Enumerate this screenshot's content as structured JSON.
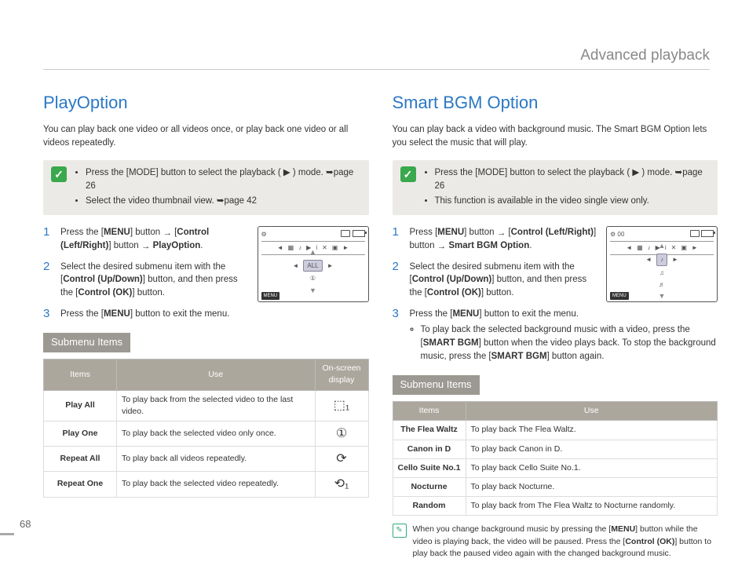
{
  "chapter_title": "Advanced playback",
  "page_number": "68",
  "left": {
    "title": "PlayOption",
    "intro": "You can play back one video or all videos once, or play back one video or all videos repeatedly.",
    "note_items": [
      "Press the [MODE] button to select the playback ( ▶ ) mode. ➥page 26",
      "Select the video thumbnail view. ➥page 42"
    ],
    "steps": [
      "Press the [MENU] button → [Control (Left/Right)] button → PlayOption.",
      "Select the desired submenu item with the [Control (Up/Down)] button, and then press the [Control (OK)] button.",
      "Press the [MENU] button to exit the menu."
    ],
    "submenu_label": "Submenu Items",
    "table": {
      "headers": [
        "Items",
        "Use",
        "On-screen display"
      ],
      "rows": [
        {
          "item": "Play All",
          "use": "To play back from the selected video to the last video.",
          "icon": "⬚₁"
        },
        {
          "item": "Play One",
          "use": "To play back the selected video only once.",
          "icon": "①"
        },
        {
          "item": "Repeat All",
          "use": "To play back all videos repeatedly.",
          "icon": "⟳"
        },
        {
          "item": "Repeat One",
          "use": "To play back the selected video repeatedly.",
          "icon": "⟲₁"
        }
      ]
    },
    "screen": {
      "menu_label": "MENU",
      "highlight": "ALL",
      "secondary": "①"
    }
  },
  "right": {
    "title": "Smart BGM Option",
    "intro": "You can play back a video with background music. The Smart BGM Option lets you select the music that will play.",
    "note_items": [
      "Press the [MODE] button to select the playback ( ▶ ) mode. ➥page 26",
      "This function is available in the video single view only."
    ],
    "steps": [
      "Press [MENU] button → [Control (Left/Right)] button → Smart BGM Option.",
      "Select the desired submenu item with the [Control (Up/Down)] button, and then press the [Control (OK)] button.",
      "Press the [MENU] button to exit the menu."
    ],
    "step3_sub": "To play back the selected background music with a video, press the [SMART BGM] button when the video plays back. To stop the background music, press the [SMART BGM] button again.",
    "submenu_label": "Submenu Items",
    "table": {
      "headers": [
        "Items",
        "Use"
      ],
      "rows": [
        {
          "item": "The Flea Waltz",
          "use": "To play back The Flea Waltz."
        },
        {
          "item": "Canon in D",
          "use": "To play back Canon in D."
        },
        {
          "item": "Cello Suite No.1",
          "use": "To play back Cello Suite No.1."
        },
        {
          "item": "Nocturne",
          "use": "To play back Nocturne."
        },
        {
          "item": "Random",
          "use": "To play back from The Flea Waltz to Nocturne randomly."
        }
      ]
    },
    "footnote": "When you change background music by pressing the [MENU] button while the video is playing back, the video will be paused. Press the [Control (OK)] button to play back the paused video again with the changed background music.",
    "screen": {
      "menu_label": "MENU",
      "items": [
        "♪",
        "♫",
        "♬"
      ]
    }
  }
}
